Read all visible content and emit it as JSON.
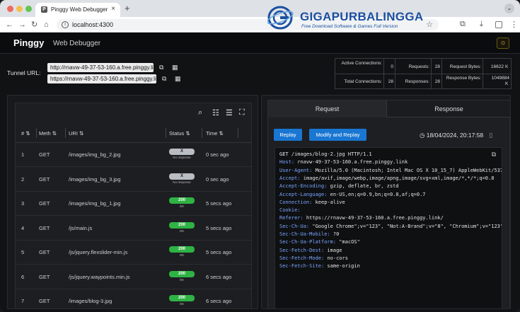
{
  "browser": {
    "tab_title": "Pinggy Web Debugger",
    "tab_favicon": "P",
    "url": "localhost:4300"
  },
  "watermark": {
    "title": "GIGAPURBALINGGA",
    "subtitle": "Free Download Software & Games Full Version"
  },
  "app": {
    "brand": "Pinggy",
    "subtitle": "Web Debugger"
  },
  "tunnel": {
    "label": "Tunnel URL:",
    "urls": [
      "http://rnavw-49-37-53-160.a.free.pinggy.link",
      "https://rnavw-49-37-53-160.a.free.pinggy.link"
    ]
  },
  "stats": {
    "active_connections_label": "Active Connections:",
    "active_connections": "0",
    "requests_label": "Requests:",
    "requests": "28",
    "request_bytes_label": "Request Bytes:",
    "request_bytes": "16622",
    "request_bytes_unit": "K",
    "total_connections_label": "Total Connections:",
    "total_connections": "28",
    "responses_label": "Responses:",
    "responses": "28",
    "response_bytes_label": "Response Bytes:",
    "response_bytes": "1049884",
    "response_bytes_unit": "K"
  },
  "table": {
    "headers": [
      "#",
      "Meth",
      "URI",
      "Status",
      "Time"
    ],
    "rows": [
      {
        "n": "1",
        "method": "GET",
        "uri": "/images/img_bg_2.jpg",
        "status": "X",
        "status_sub": "No response",
        "kind": "x",
        "time": "0 sec ago"
      },
      {
        "n": "2",
        "method": "GET",
        "uri": "/images/img_bg_3.jpg",
        "status": "X",
        "status_sub": "No response",
        "kind": "x",
        "time": "0 sec ago"
      },
      {
        "n": "3",
        "method": "GET",
        "uri": "/images/img_bg_1.jpg",
        "status": "200",
        "status_sub": "OK",
        "kind": "ok",
        "time": "5 secs ago"
      },
      {
        "n": "4",
        "method": "GET",
        "uri": "/js/main.js",
        "status": "200",
        "status_sub": "OK",
        "kind": "ok",
        "time": "5 secs ago"
      },
      {
        "n": "5",
        "method": "GET",
        "uri": "/js/jquery.flexslider-min.js",
        "status": "200",
        "status_sub": "OK",
        "kind": "ok",
        "time": "5 secs ago"
      },
      {
        "n": "6",
        "method": "GET",
        "uri": "/js/jquery.waypoints.min.js",
        "status": "200",
        "status_sub": "OK",
        "kind": "ok",
        "time": "6 secs ago"
      },
      {
        "n": "7",
        "method": "GET",
        "uri": "/images/blog-3.jpg",
        "status": "200",
        "status_sub": "OK",
        "kind": "ok",
        "time": "6 secs ago"
      }
    ]
  },
  "detail": {
    "tab_request": "Request",
    "tab_response": "Response",
    "replay_label": "Replay",
    "modify_replay_label": "Modify and Replay",
    "timestamp": "18/04/2024, 20:17:58",
    "raw": [
      {
        "k": "",
        "v": "GET /images/blog-2.jpg HTTP/1.1"
      },
      {
        "k": "Host:",
        "v": " rnavw-49-37-53-160.a.free.pinggy.link"
      },
      {
        "k": "User-Agent:",
        "v": " Mozilla/5.0 (Macintosh; Intel Mac OS X 10_15_7) AppleWebKit/537."
      },
      {
        "k": "Accept:",
        "v": " image/avif,image/webp,image/apng,image/svg+xml,image/*,*/*;q=0.8"
      },
      {
        "k": "Accept-Encoding:",
        "v": " gzip, deflate, br, zstd"
      },
      {
        "k": "Accept-Language:",
        "v": " en-US,en;q=0.9,bn;q=0.8,af;q=0.7"
      },
      {
        "k": "Connection:",
        "v": " keep-alive"
      },
      {
        "k": "Cookie:",
        "v": ""
      },
      {
        "k": "Referer:",
        "v": " https://rnavw-49-37-53-160.a.free.pinggy.link/"
      },
      {
        "k": "Sec-Ch-Ua:",
        "v": " \"Google Chrome\";v=\"123\", \"Not:A-Brand\";v=\"8\", \"Chromium\";v=\"123\""
      },
      {
        "k": "Sec-Ch-Ua-Mobile:",
        "v": " ?0"
      },
      {
        "k": "Sec-Ch-Ua-Platform:",
        "v": " \"macOS\""
      },
      {
        "k": "Sec-Fetch-Dest:",
        "v": " image"
      },
      {
        "k": "Sec-Fetch-Mode:",
        "v": " no-cors"
      },
      {
        "k": "Sec-Fetch-Site:",
        "v": " same-origin"
      }
    ]
  },
  "colors": {
    "accent": "#1976d2",
    "status_ok": "#2fb344",
    "status_none": "#b9bcc3",
    "theme_icon": "#f1c232"
  },
  "icons": [
    "search-icon",
    "columns-icon",
    "filter-icon",
    "fullscreen-icon",
    "copy-icon",
    "qr-icon",
    "clock-icon",
    "sun-icon"
  ]
}
